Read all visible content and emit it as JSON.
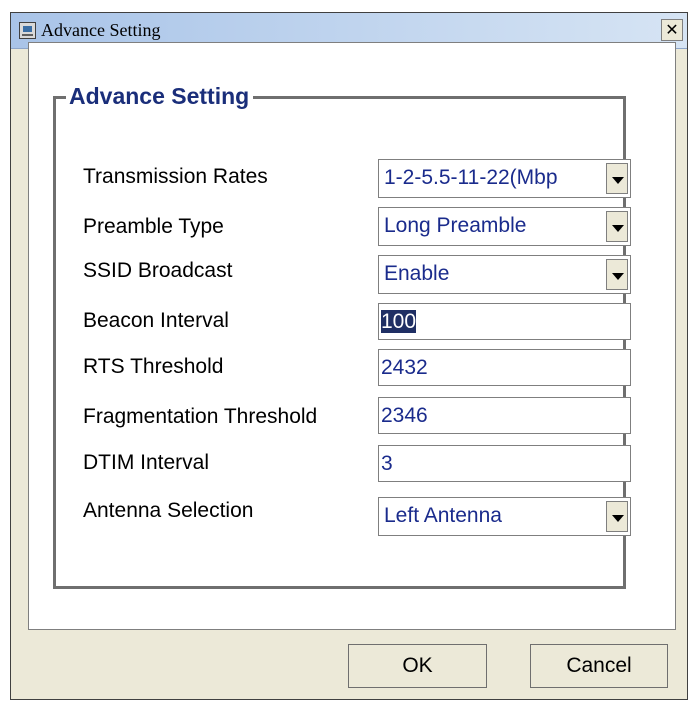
{
  "window": {
    "title": "Advance Setting",
    "close_glyph": "✕"
  },
  "group": {
    "title": "Advance Setting"
  },
  "fields": {
    "transmission_rates": {
      "label": "Transmission Rates",
      "value": "1-2-5.5-11-22(Mbp"
    },
    "preamble_type": {
      "label": "Preamble Type",
      "value": "Long Preamble"
    },
    "ssid_broadcast": {
      "label": "SSID Broadcast",
      "value": "Enable"
    },
    "beacon_interval": {
      "label": "Beacon Interval",
      "value": "100"
    },
    "rts_threshold": {
      "label": "RTS Threshold",
      "value": "2432"
    },
    "fragmentation_threshold": {
      "label": "Fragmentation Threshold",
      "value": "2346"
    },
    "dtim_interval": {
      "label": "DTIM Interval",
      "value": "3"
    },
    "antenna_selection": {
      "label": "Antenna Selection",
      "value": "Left Antenna"
    }
  },
  "buttons": {
    "ok": "OK",
    "cancel": "Cancel"
  },
  "colors": {
    "value_text": "#1a2b8c",
    "group_title": "#1a2e7a",
    "selection_bg": "#1f2f64"
  }
}
